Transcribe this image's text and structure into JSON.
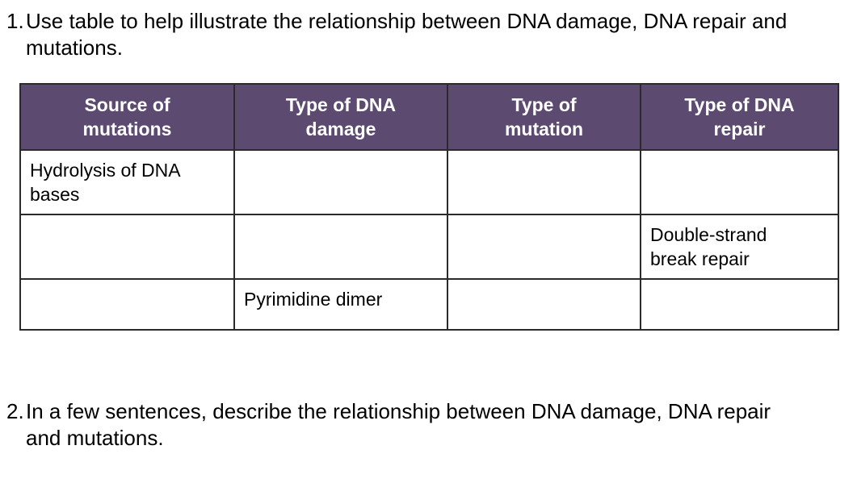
{
  "colors": {
    "header_background": "#5C4A70",
    "header_text": "#FFFFFF",
    "border": "#2B2B2B",
    "body_text": "#000000",
    "page_background": "#FFFFFF"
  },
  "questions": [
    {
      "number": "1.",
      "text": "Use table to help illustrate the relationship between DNA damage, DNA repair and mutations."
    },
    {
      "number": "2.",
      "text": "In a few sentences, describe the relationship between DNA damage, DNA repair and mutations."
    }
  ],
  "table": {
    "headers": [
      "Source of\nmutations",
      "Type of DNA\ndamage",
      "Type of\nmutation",
      "Type of DNA\nrepair"
    ],
    "rows": [
      {
        "cells": [
          "Hydrolysis of DNA\nbases",
          "",
          "",
          ""
        ]
      },
      {
        "cells": [
          "",
          "",
          "",
          "Double-strand\nbreak repair"
        ]
      },
      {
        "cells": [
          "",
          "Pyrimidine dimer",
          "",
          ""
        ]
      }
    ]
  }
}
